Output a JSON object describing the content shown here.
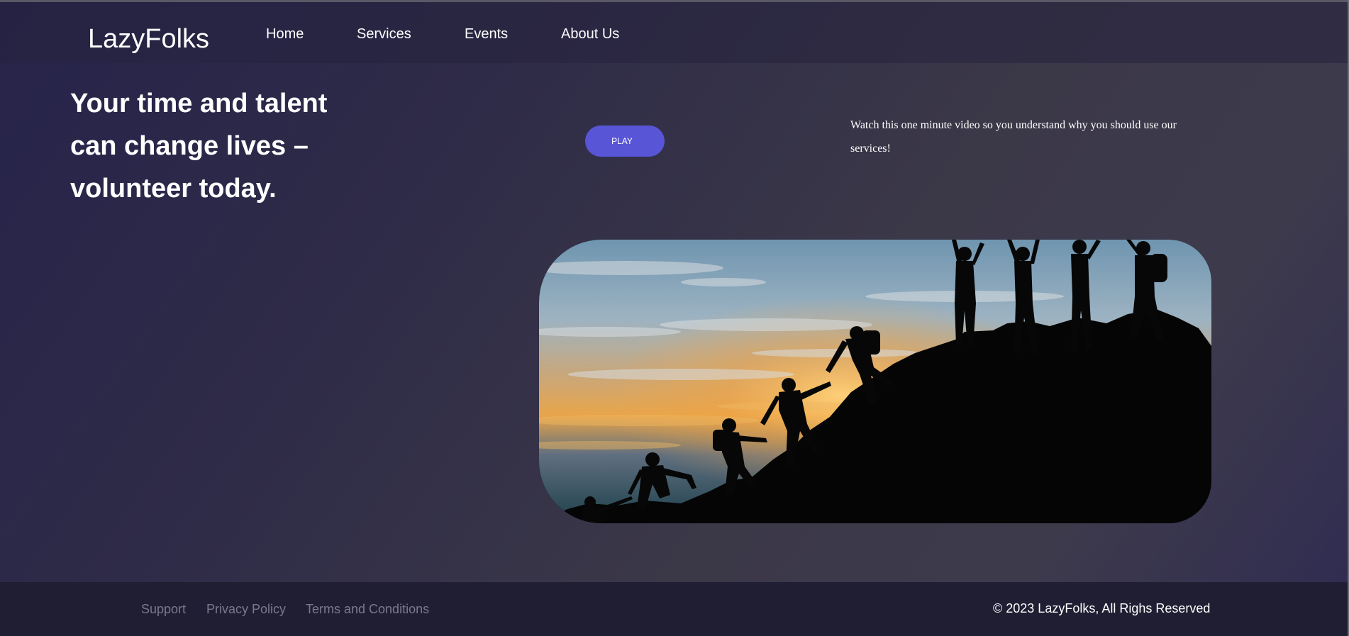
{
  "header": {
    "logo": "LazyFolks",
    "nav": [
      {
        "label": "Home"
      },
      {
        "label": "Services"
      },
      {
        "label": "Events"
      },
      {
        "label": "About Us"
      }
    ]
  },
  "hero": {
    "title": "Your time and talent can change lives – volunteer today.",
    "play_label": "PLAY",
    "video_note": "Watch this one minute video so you understand why you should use our services!",
    "image": "silhouette-team-climbing-mountain-at-sunset"
  },
  "footer": {
    "links": [
      {
        "label": "Support"
      },
      {
        "label": "Privacy Policy"
      },
      {
        "label": "Terms and Conditions"
      }
    ],
    "copyright": "© 2023 LazyFolks, All Righs Reserved"
  },
  "colors": {
    "accent": "#5855d6",
    "footer_bg": "#201e33",
    "footer_link": "#7b7989",
    "background": "#2e2b48"
  }
}
